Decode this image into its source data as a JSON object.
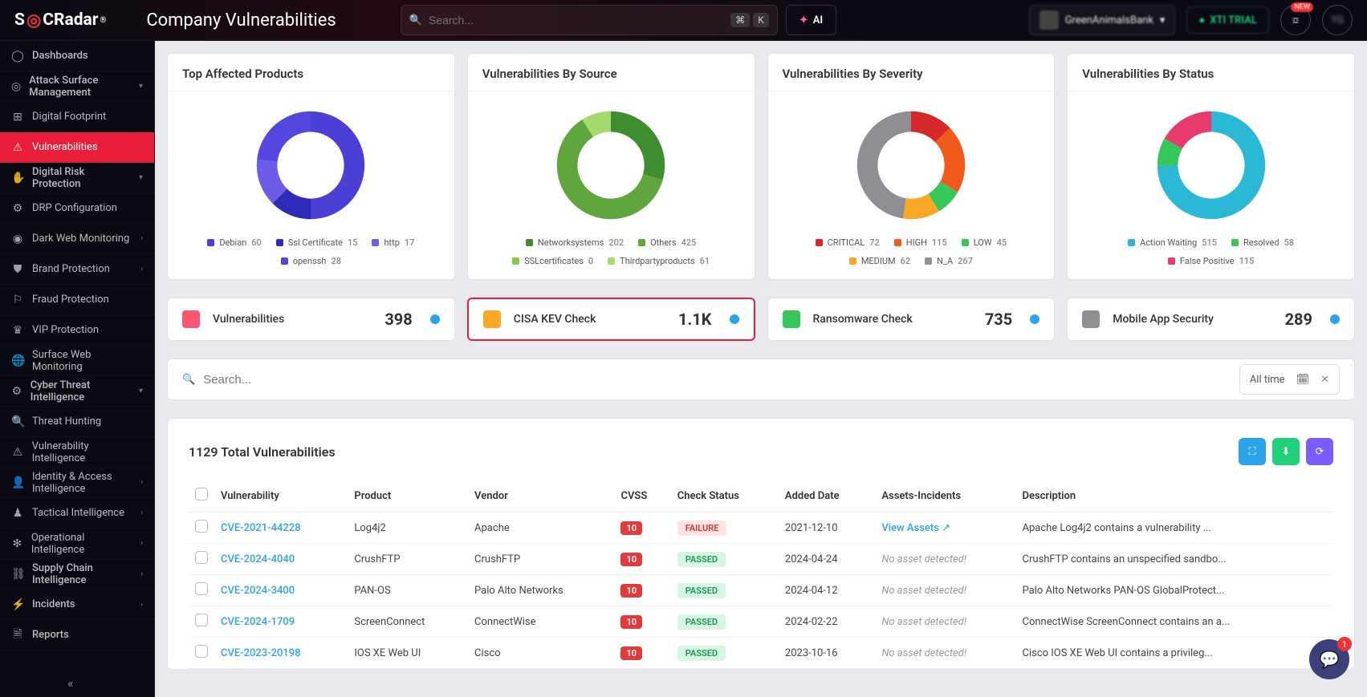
{
  "header": {
    "brand": "SOCRadar",
    "page_title": "Company Vulnerabilities",
    "search_placeholder": "Search...",
    "kbd1": "⌘",
    "kbd2": "K",
    "ai_label": "AI",
    "org_name": "GreenAnimalsBank",
    "trial_label": "XTI TRIAL"
  },
  "sidebar": {
    "items0": {
      "label": "Dashboards"
    },
    "items1": {
      "label": "Attack Surface Management"
    },
    "items2": {
      "label": "Digital Footprint"
    },
    "items3": {
      "label": "Vulnerabilities"
    },
    "items4": {
      "label": "Digital Risk Protection"
    },
    "items5": {
      "label": "DRP Configuration"
    },
    "items6": {
      "label": "Dark Web Monitoring"
    },
    "items7": {
      "label": "Brand Protection"
    },
    "items8": {
      "label": "Fraud Protection"
    },
    "items9": {
      "label": "VIP Protection"
    },
    "items10": {
      "label": "Surface Web Monitoring"
    },
    "items11": {
      "label": "Cyber Threat Intelligence"
    },
    "items12": {
      "label": "Threat Hunting"
    },
    "items13": {
      "label": "Vulnerability Intelligence"
    },
    "items14": {
      "label": "Identity & Access Intelligence"
    },
    "items15": {
      "label": "Tactical Intelligence"
    },
    "items16": {
      "label": "Operational Intelligence"
    },
    "items17": {
      "label": "Supply Chain Intelligence"
    },
    "items18": {
      "label": "Incidents"
    },
    "items19": {
      "label": "Reports"
    }
  },
  "charts": {
    "c0": {
      "title": "Top Affected Products"
    },
    "c1": {
      "title": "Vulnerabilities By Source"
    },
    "c2": {
      "title": "Vulnerabilities By Severity"
    },
    "c3": {
      "title": "Vulnerabilities By Status"
    }
  },
  "chart_data": [
    {
      "type": "pie",
      "title": "Top Affected Products",
      "series": [
        {
          "name": "Debian",
          "value": 60,
          "color": "#4b3fd6"
        },
        {
          "name": "Ssl Certificate",
          "value": 15,
          "color": "#2f2bb8"
        },
        {
          "name": "http",
          "value": 17,
          "color": "#6c5ce7"
        },
        {
          "name": "openssh",
          "value": 28,
          "color": "#5546e0"
        }
      ]
    },
    {
      "type": "pie",
      "title": "Vulnerabilities By Source",
      "series": [
        {
          "name": "Networksystems",
          "value": 202,
          "color": "#3e8e2f"
        },
        {
          "name": "Others",
          "value": 425,
          "color": "#5fa63c"
        },
        {
          "name": "SSLcertificates",
          "value": 0,
          "color": "#86c94e"
        },
        {
          "name": "Thirdpartyproducts",
          "value": 61,
          "color": "#a4d96c"
        }
      ]
    },
    {
      "type": "pie",
      "title": "Vulnerabilities By Severity",
      "series": [
        {
          "name": "CRITICAL",
          "value": 72,
          "color": "#d62828"
        },
        {
          "name": "HIGH",
          "value": 115,
          "color": "#f05a1a"
        },
        {
          "name": "LOW",
          "value": 45,
          "color": "#35c759"
        },
        {
          "name": "MEDIUM",
          "value": 62,
          "color": "#f9a825"
        },
        {
          "name": "N_A",
          "value": 267,
          "color": "#8e8e93"
        }
      ]
    },
    {
      "type": "pie",
      "title": "Vulnerabilities By Status",
      "series": [
        {
          "name": "Action Waiting",
          "value": 515,
          "color": "#2bb8d6"
        },
        {
          "name": "Resolved",
          "value": 58,
          "color": "#35c759"
        },
        {
          "name": "False Positive",
          "value": 115,
          "color": "#e83a6d"
        }
      ]
    }
  ],
  "stats": {
    "s0": {
      "label": "Vulnerabilities",
      "value": "398",
      "color": "#ff5670"
    },
    "s1": {
      "label": "CISA KEV Check",
      "value": "1.1K",
      "color": "#f9a825"
    },
    "s2": {
      "label": "Ransomware Check",
      "value": "735",
      "color": "#35c759"
    },
    "s3": {
      "label": "Mobile App Security",
      "value": "289",
      "color": "#8e8e93"
    }
  },
  "filter": {
    "search_placeholder": "Search...",
    "time_label": "All time"
  },
  "table": {
    "total_text": "1129 Total Vulnerabilities",
    "headers": {
      "h0": "Vulnerability",
      "h1": "Product",
      "h2": "Vendor",
      "h3": "CVSS",
      "h4": "Check Status",
      "h5": "Added Date",
      "h6": "Assets-Incidents",
      "h7": "Description"
    },
    "rows": {
      "r0": {
        "cve": "CVE-2021-44228",
        "product": "Log4j2",
        "vendor": "Apache",
        "cvss": "10",
        "status": "FAILURE",
        "status_kind": "fail",
        "date": "2021-12-10",
        "assets": "View Assets",
        "assets_kind": "link",
        "desc": "Apache Log4j2 contains a vulnerability ..."
      },
      "r1": {
        "cve": "CVE-2024-4040",
        "product": "CrushFTP",
        "vendor": "CrushFTP",
        "cvss": "10",
        "status": "PASSED",
        "status_kind": "pass",
        "date": "2024-04-24",
        "assets": "No asset detected!",
        "assets_kind": "none",
        "desc": "CrushFTP contains an unspecified sandbo..."
      },
      "r2": {
        "cve": "CVE-2024-3400",
        "product": "PAN-OS",
        "vendor": "Palo Alto Networks",
        "cvss": "10",
        "status": "PASSED",
        "status_kind": "pass",
        "date": "2024-04-12",
        "assets": "No asset detected!",
        "assets_kind": "none",
        "desc": "Palo Alto Networks PAN-OS GlobalProtect..."
      },
      "r3": {
        "cve": "CVE-2024-1709",
        "product": "ScreenConnect",
        "vendor": "ConnectWise",
        "cvss": "10",
        "status": "PASSED",
        "status_kind": "pass",
        "date": "2024-02-22",
        "assets": "No asset detected!",
        "assets_kind": "none",
        "desc": "ConnectWise ScreenConnect contains an a..."
      },
      "r4": {
        "cve": "CVE-2023-20198",
        "product": "IOS XE Web UI",
        "vendor": "Cisco",
        "cvss": "10",
        "status": "PASSED",
        "status_kind": "pass",
        "date": "2023-10-16",
        "assets": "No asset detected!",
        "assets_kind": "none",
        "desc": "Cisco IOS XE Web UI contains a privileg..."
      }
    }
  },
  "fab": {
    "badge": "1"
  }
}
